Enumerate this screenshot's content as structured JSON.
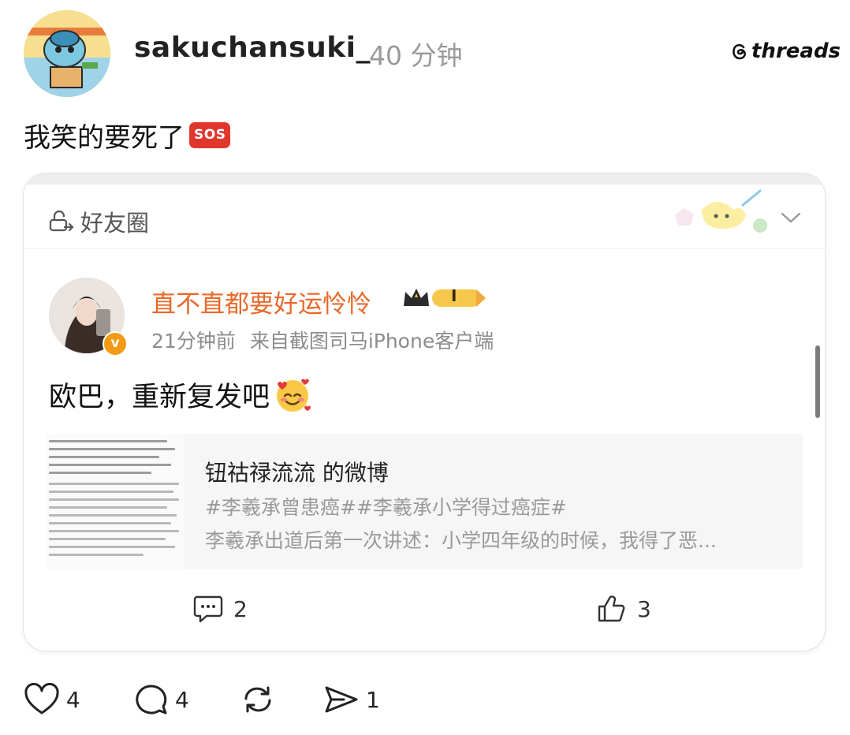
{
  "post": {
    "username": "sakuchansuki_",
    "time": "40 分钟",
    "brand": "threads",
    "text": "我笑的要死了",
    "emoji_label": "SOS"
  },
  "embed": {
    "circle_label": "好友圈",
    "weibo": {
      "name": "直不直都要好运怜怜",
      "level_badge": "I",
      "verified_mark": "v",
      "time": "21分钟前",
      "source": "来自截图司马iPhone客户端",
      "text": "欧巴，重新复发吧",
      "link": {
        "title": "钮祜禄流流 的微博",
        "tags": "#李羲承曾患癌##李羲承小学得过癌症#",
        "desc": "李羲承出道后第一次讲述：小学四年级的时候，我得了恶..."
      },
      "comments": "2",
      "likes": "3"
    }
  },
  "actions": {
    "likes": "4",
    "replies": "4",
    "shares": "1"
  },
  "colors": {
    "weibo_name": "#e8692a",
    "verified_badge": "#f29a16",
    "sos_bg": "#e0362c"
  }
}
